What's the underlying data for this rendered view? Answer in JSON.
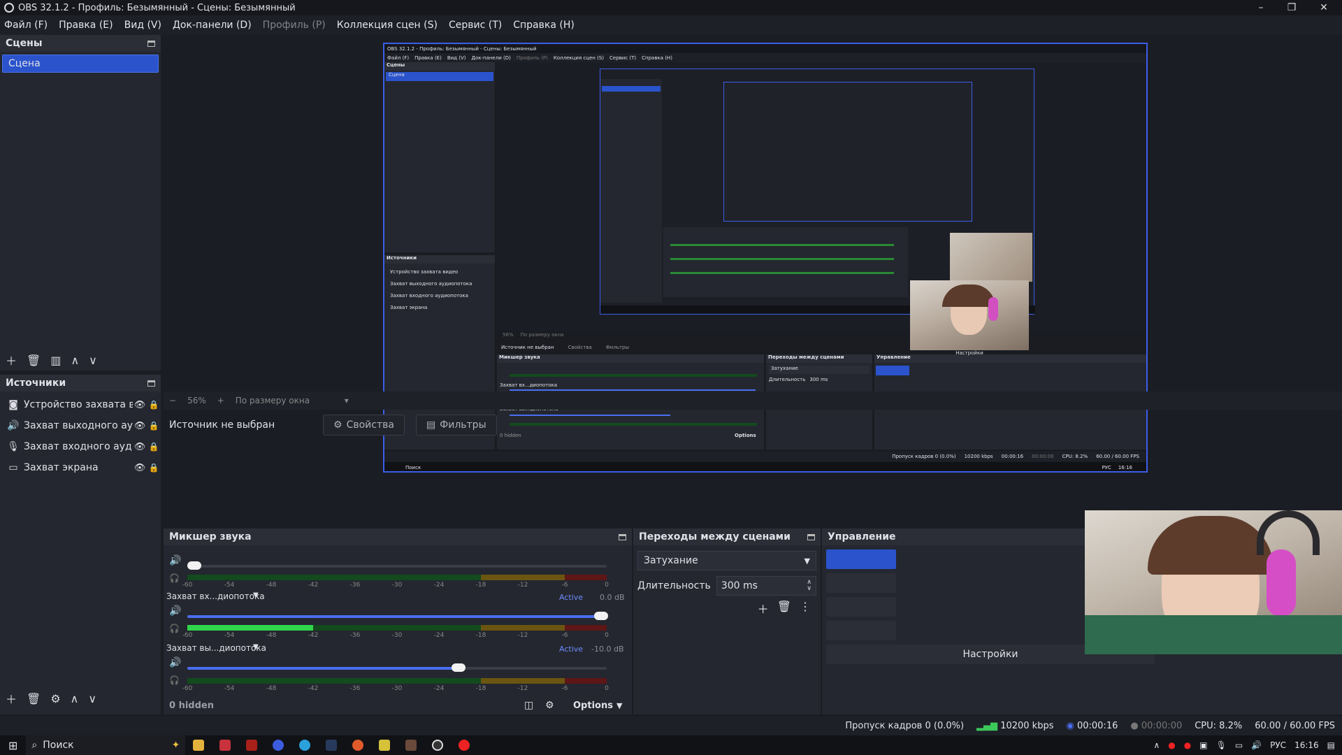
{
  "window": {
    "title": "OBS 32.1.2 - Профиль: Безымянный - Сцены: Безымянный"
  },
  "menu": [
    "Файл (F)",
    "Правка (E)",
    "Вид (V)",
    "Док-панели (D)",
    "Профиль (P)",
    "Коллекция сцен (S)",
    "Сервис (T)",
    "Справка (H)"
  ],
  "scenes": {
    "title": "Сцены",
    "items": [
      "Сцена"
    ]
  },
  "sources": {
    "title": "Источники",
    "items": [
      {
        "icon": "camera-icon",
        "label": "Устройство захвата видео"
      },
      {
        "icon": "speaker-icon",
        "label": "Захват выходного аудиопотока"
      },
      {
        "icon": "microphone-icon",
        "label": "Захват входного аудиопотока"
      },
      {
        "icon": "monitor-icon",
        "label": "Захват экрана"
      }
    ]
  },
  "zoom": {
    "minus": "−",
    "value": "56%",
    "plus": "+",
    "fit": "По размеру окна"
  },
  "properties": {
    "no_source": "Источник не выбран",
    "props": "Свойства",
    "filters": "Фильтры"
  },
  "mixer": {
    "title": "Микшер звука",
    "ticks": [
      "-60",
      "-54",
      "-48",
      "-42",
      "-36",
      "-30",
      "-24",
      "-18",
      "-12",
      "-6",
      "0"
    ],
    "channels": [
      {
        "name": "",
        "active": "",
        "db": "",
        "volume": 0.0,
        "level": 0.0
      },
      {
        "name": "Захват вх...диопотока",
        "active": "Active",
        "db": "0.0 dB",
        "volume": 1.0,
        "level": 0.3
      },
      {
        "name": "Захват вы...диопотока",
        "active": "Active",
        "db": "-10.0 dB",
        "volume": 0.66,
        "level": 0.0
      }
    ],
    "hidden": "0 hidden",
    "options": "Options"
  },
  "transitions": {
    "title": "Переходы между сценами",
    "selected": "Затухание",
    "duration_label": "Длительность",
    "duration_value": "300 ms"
  },
  "controls": {
    "title": "Управление",
    "settings": "Настройки"
  },
  "status": {
    "dropped": "Пропуск кадров 0 (0.0%)",
    "bitrate": "10200 kbps",
    "stream_time": "00:00:16",
    "rec_time": "00:00:00",
    "cpu": "CPU: 8.2%",
    "fps": "60.00 / 60.00 FPS"
  },
  "taskbar": {
    "search": "Поиск",
    "lang": "РУС",
    "time": "16:16"
  },
  "nested": {
    "title": "OBS 32.1.2 - Профиль: Безымянный - Сцены: Безымянный",
    "menu": [
      "Файл (F)",
      "Правка (E)",
      "Вид (V)",
      "Док-панели (D)",
      "Профиль (P)",
      "Коллекция сцен (S)",
      "Сервис (T)",
      "Справка (H)"
    ],
    "scenes_title": "Сцены",
    "scene": "Сцена",
    "sources_title": "Источники",
    "sources": [
      "Устройство захвата видео",
      "Захват выходного аудиопотока",
      "Захват входного аудиопотока",
      "Захват экрана"
    ],
    "no_source": "Источник не выбран",
    "props": "Свойства",
    "filters": "Фильтры",
    "mixer_title": "Микшер звука",
    "ch1": "Захват вх...диопотока",
    "ch2": "Захват вы...диопотока",
    "hidden": "0 hidden",
    "options": "Options",
    "transitions_title": "Переходы между сценами",
    "trans": "Затухание",
    "duration": "Длительность",
    "duration_value": "300 ms",
    "controls_title": "Управление",
    "settings": "Настройки",
    "zoom_value": "56%",
    "zoom_fit": "По размеру окна",
    "status": [
      "Пропуск кадров 0 (0.0%)",
      "10200 kbps",
      "00:00:16",
      "00:00:00",
      "CPU: 8.2%",
      "60.00 / 60.00 FPS"
    ],
    "search": "Поиск",
    "lang": "РУС",
    "time": "16:16"
  },
  "colors": {
    "accent": "#2a53cc",
    "panel": "#24272f",
    "bg": "#1b1d24"
  }
}
